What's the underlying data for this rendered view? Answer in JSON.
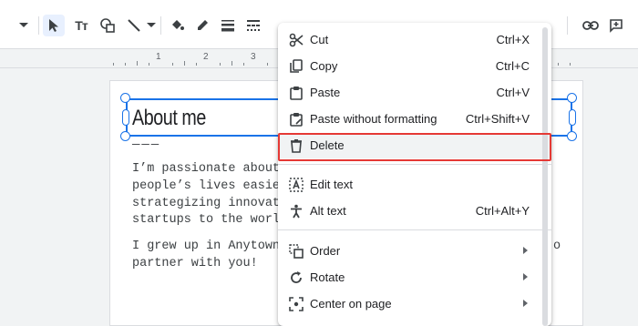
{
  "toolbar": {
    "icons": [
      "chevron-down-icon",
      "select-arrow-icon",
      "text-box-icon",
      "shape-icon",
      "line-icon",
      "fill-color-icon",
      "border-color-icon",
      "border-weight-icon",
      "border-dash-icon",
      "link-icon",
      "comment-icon"
    ],
    "text_tool_label": "Tт"
  },
  "ruler": {
    "numbers": [
      "1",
      "2",
      "3"
    ]
  },
  "slide": {
    "title": "About me",
    "dash": "———",
    "body_lines": [
      "I’m passionate about",
      "people’s lives easie",
      "strategizing innovat",
      "startups to the worl",
      "I grew up in Anytown,",
      "partner with you!"
    ],
    "body_tail": "o"
  },
  "menu": {
    "items": [
      {
        "label": "Cut",
        "shortcut": "Ctrl+X",
        "icon": "scissors-icon"
      },
      {
        "label": "Copy",
        "shortcut": "Ctrl+C",
        "icon": "copy-icon"
      },
      {
        "label": "Paste",
        "shortcut": "Ctrl+V",
        "icon": "clipboard-icon"
      },
      {
        "label": "Paste without formatting",
        "shortcut": "Ctrl+Shift+V",
        "icon": "clipboard-format-icon"
      },
      {
        "label": "Delete",
        "shortcut": "",
        "icon": "trash-icon"
      },
      {
        "label": "Edit text",
        "shortcut": "",
        "icon": "edit-text-icon"
      },
      {
        "label": "Alt text",
        "shortcut": "Ctrl+Alt+Y",
        "icon": "accessibility-icon"
      },
      {
        "label": "Order",
        "shortcut": "",
        "icon": "order-icon"
      },
      {
        "label": "Rotate",
        "shortcut": "",
        "icon": "rotate-icon"
      },
      {
        "label": "Center on page",
        "shortcut": "",
        "icon": "center-icon"
      }
    ]
  },
  "colors": {
    "accent": "#1a73e8",
    "highlight_border": "#e53935",
    "menu_hover": "#f1f3f4"
  }
}
